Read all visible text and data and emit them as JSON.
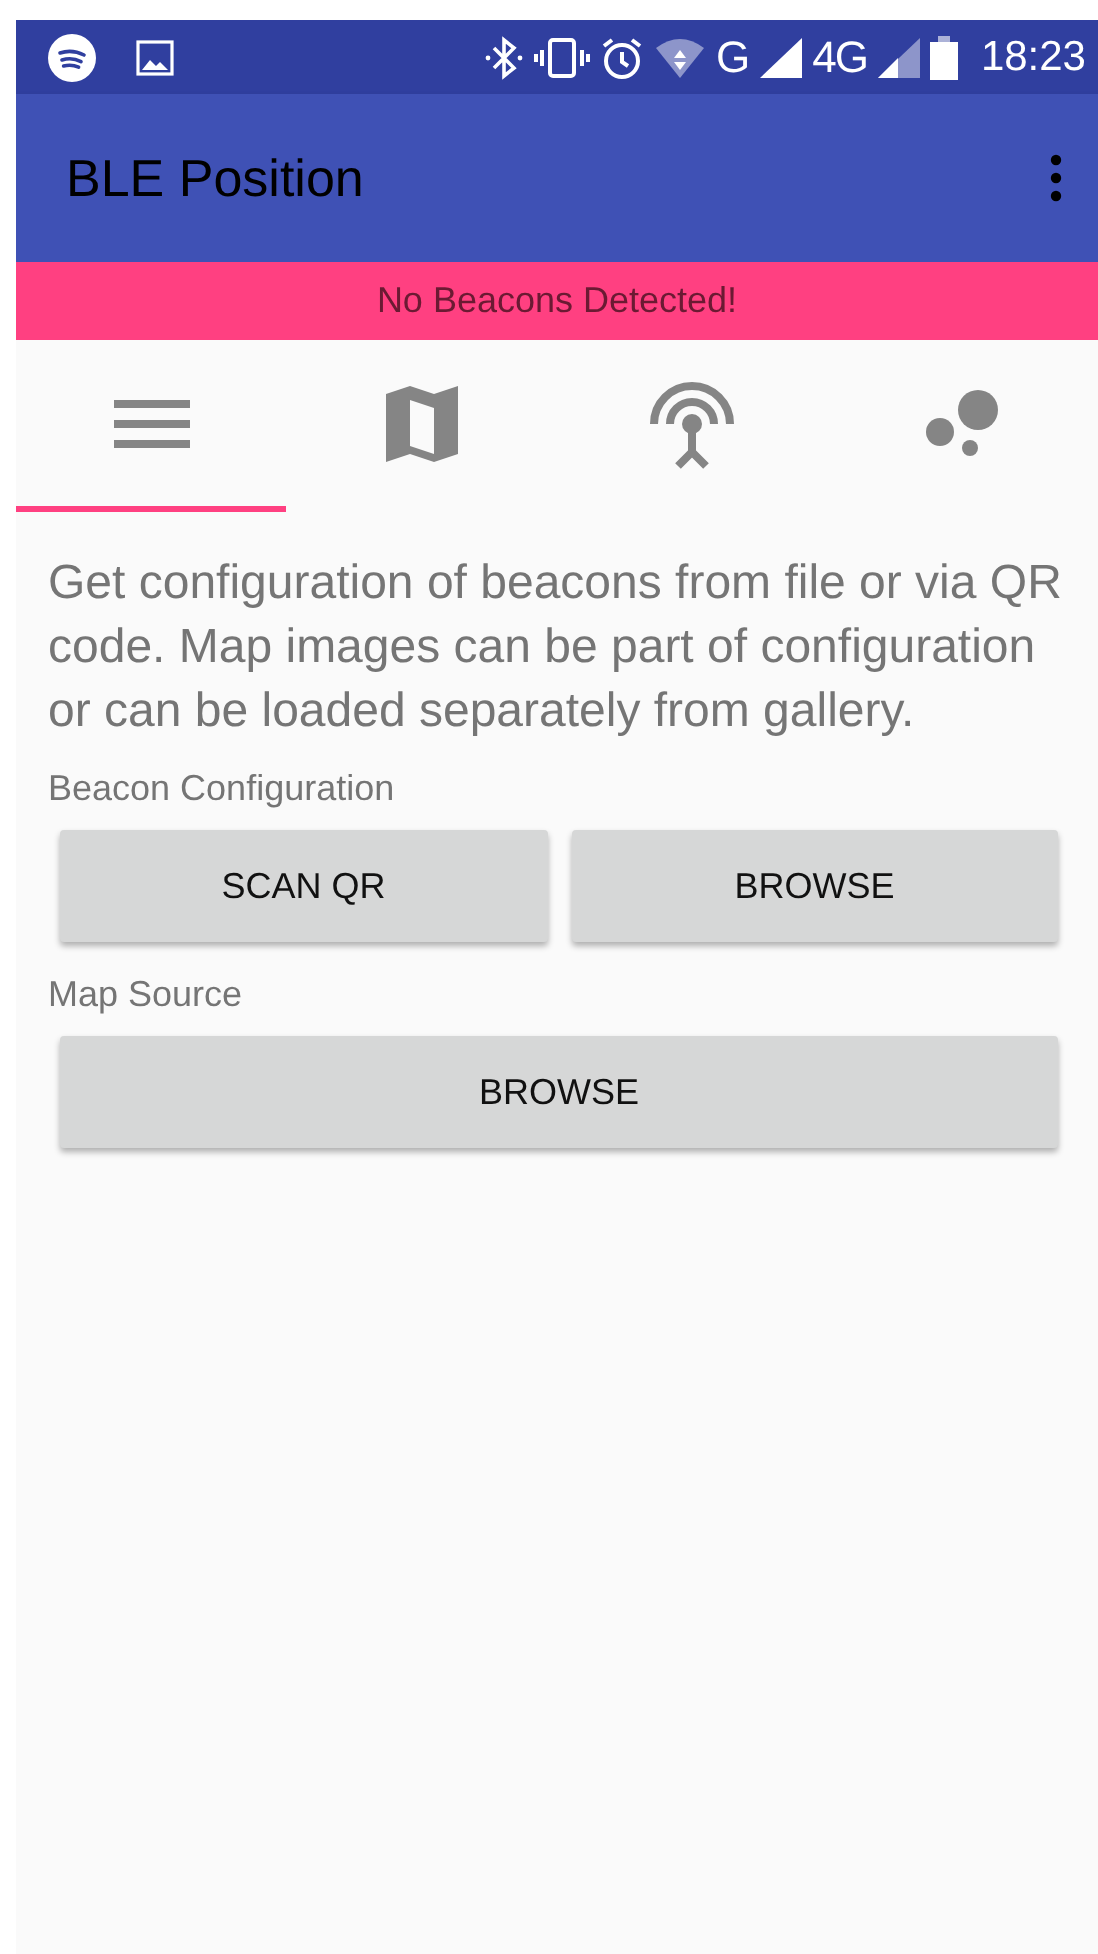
{
  "status_bar": {
    "network_labels": [
      "G",
      "4G"
    ],
    "time": "18:23"
  },
  "app_bar": {
    "title": "BLE Position"
  },
  "banner": {
    "text": "No Beacons Detected!"
  },
  "tabs": [
    {
      "kind": "list",
      "selected": true
    },
    {
      "kind": "map",
      "selected": false
    },
    {
      "kind": "beacon",
      "selected": false
    },
    {
      "kind": "dots",
      "selected": false
    }
  ],
  "description": "Get configuration of beacons from file or via QR code. Map images can be part of configuration or can be loaded separately from gallery.",
  "sections": [
    {
      "label": "Beacon Configuration",
      "buttons": [
        "SCAN QR",
        "BROWSE"
      ]
    },
    {
      "label": "Map Source",
      "buttons": [
        "BROWSE"
      ]
    }
  ]
}
